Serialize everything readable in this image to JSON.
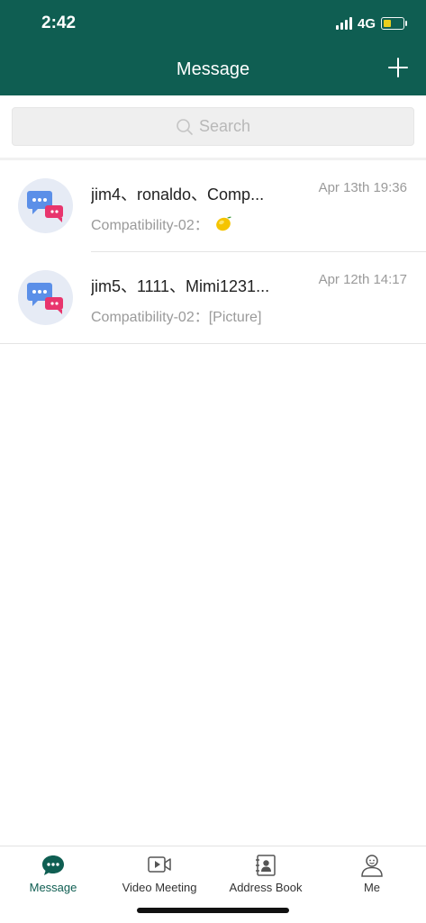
{
  "status": {
    "time": "2:42",
    "network": "4G"
  },
  "header": {
    "title": "Message"
  },
  "search": {
    "placeholder": "Search"
  },
  "conversations": [
    {
      "name": "jim4、ronaldo、Comp...",
      "time": "Apr 13th  19:36",
      "preview": "Compatibility-02：",
      "preview_icon": "lemon-emoji"
    },
    {
      "name": "jim5、1111、Mimi1231...",
      "time": "Apr 12th  14:17",
      "preview": "Compatibility-02：[Picture]"
    }
  ],
  "nav": [
    {
      "label": "Message",
      "icon": "message-icon",
      "active": true
    },
    {
      "label": "Video Meeting",
      "icon": "video-meeting-icon"
    },
    {
      "label": "Address Book",
      "icon": "address-book-icon"
    },
    {
      "label": "Me",
      "icon": "me-icon"
    }
  ],
  "colors": {
    "brand": "#0f5e52",
    "battery": "#f7d51c"
  }
}
